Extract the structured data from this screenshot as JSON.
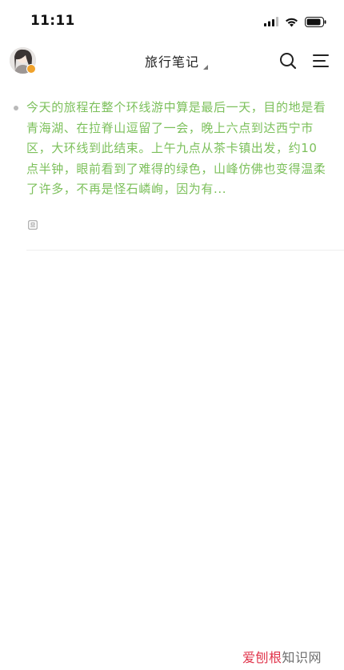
{
  "status_bar": {
    "time": "11:11"
  },
  "header": {
    "title": "旅行笔记",
    "avatar_icon": "user-avatar",
    "search_icon": "search-icon",
    "menu_icon": "menu-icon"
  },
  "notes": [
    {
      "text": "今天的旅程在整个环线游中算是最后一天，目的地是看青海湖、在拉脊山逗留了一会，晚上六点到达西宁市区，大环线到此结束。上午九点从茶卡镇出发，约10点半钟，眼前看到了难得的绿色，山峰仿佛也变得温柔了许多，不再是怪石嶙峋，因为有...",
      "attachment_icon": "image-attachment-icon"
    }
  ],
  "watermark": {
    "brand": "爱刨根",
    "suffix": "知识网"
  },
  "colors": {
    "note_text": "#7cc05b",
    "background": "#ffffff",
    "badge": "#f0a22b"
  }
}
